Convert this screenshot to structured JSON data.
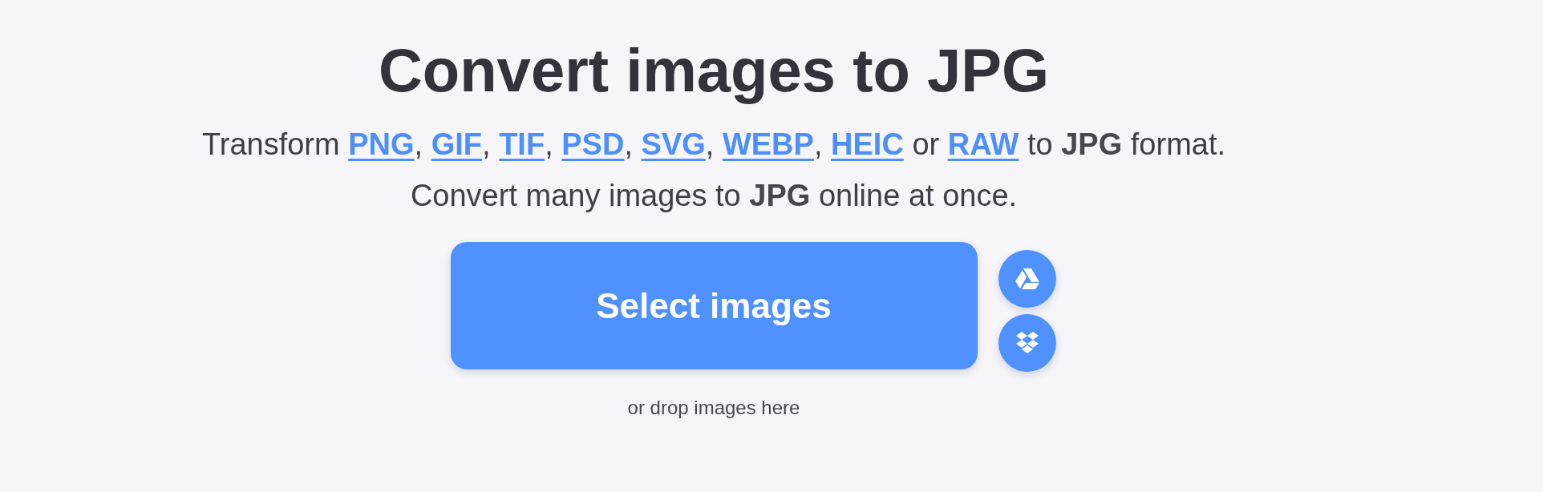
{
  "title": "Convert images to JPG",
  "intro": [
    {
      "kind": "text",
      "text": "Transform "
    },
    {
      "kind": "link",
      "text": "PNG"
    },
    {
      "kind": "text",
      "text": ", "
    },
    {
      "kind": "link",
      "text": "GIF"
    },
    {
      "kind": "text",
      "text": ", "
    },
    {
      "kind": "link",
      "text": "TIF"
    },
    {
      "kind": "text",
      "text": ", "
    },
    {
      "kind": "link",
      "text": "PSD"
    },
    {
      "kind": "text",
      "text": ", "
    },
    {
      "kind": "link",
      "text": "SVG"
    },
    {
      "kind": "text",
      "text": ", "
    },
    {
      "kind": "link",
      "text": "WEBP"
    },
    {
      "kind": "text",
      "text": ", "
    },
    {
      "kind": "link",
      "text": "HEIC"
    },
    {
      "kind": "text",
      "text": " or "
    },
    {
      "kind": "link",
      "text": "RAW"
    },
    {
      "kind": "text",
      "text": " to **JPG** format."
    }
  ],
  "intro_line_2": "Convert many images to **JPG** online at once.",
  "select_button": "Select images",
  "sources": [
    {
      "kind": "drive"
    },
    {
      "kind": "dropbox"
    }
  ],
  "drop_hint": "or drop images here"
}
